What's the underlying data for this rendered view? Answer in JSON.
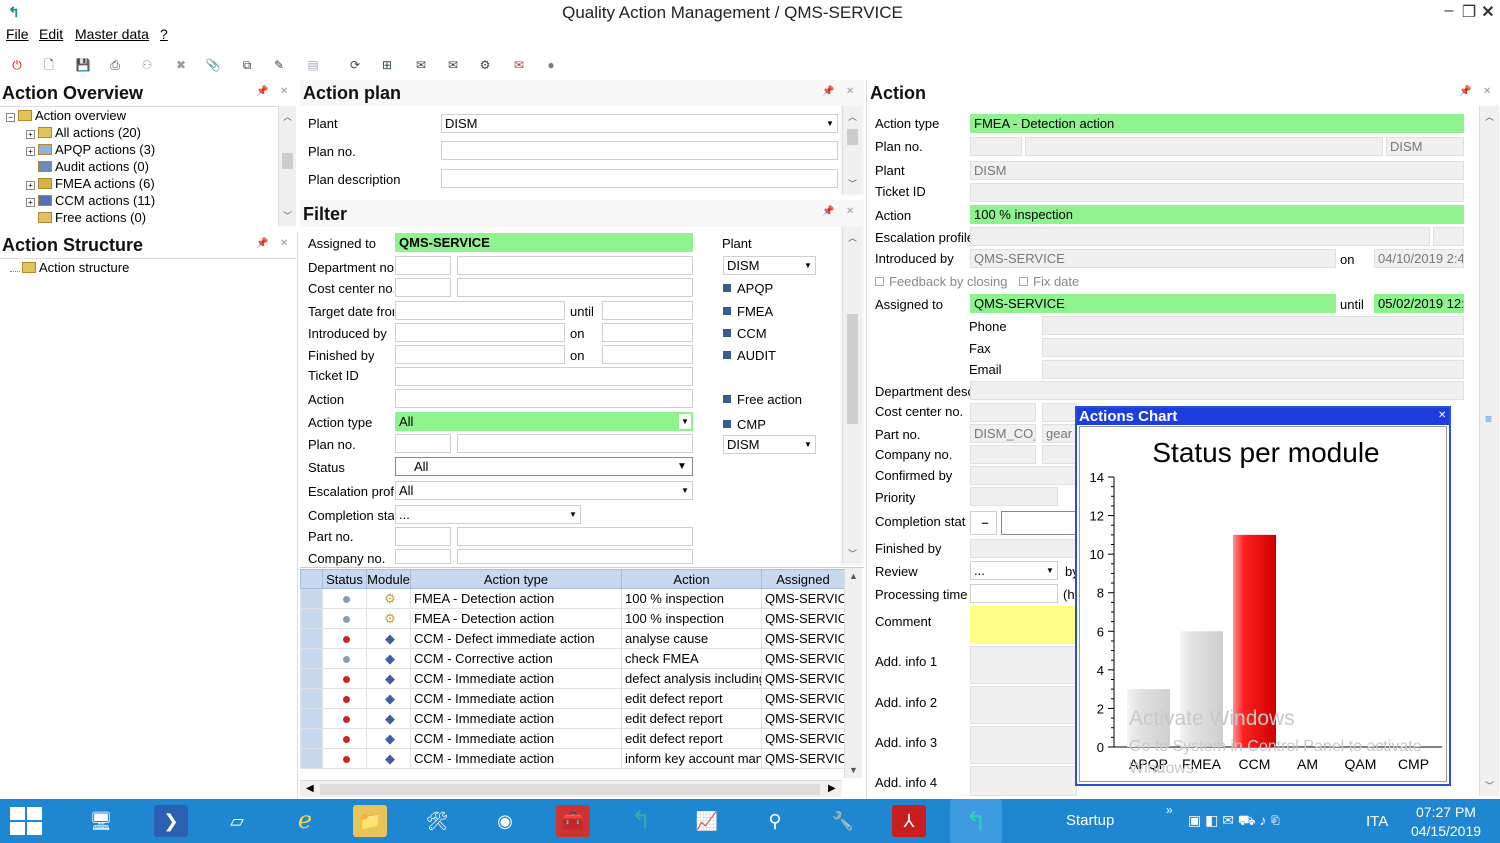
{
  "window": {
    "title": "Quality Action Management / QMS-SERVICE"
  },
  "menu": [
    "File",
    "Edit",
    "Master data",
    "?"
  ],
  "overview": {
    "title": "Action Overview",
    "items": [
      {
        "label": "Action overview"
      },
      {
        "label": "All actions (20)"
      },
      {
        "label": "APQP actions (3)"
      },
      {
        "label": "Audit actions (0)"
      },
      {
        "label": "FMEA actions (6)"
      },
      {
        "label": "CCM actions (11)"
      },
      {
        "label": "Free actions (0)"
      }
    ]
  },
  "structure": {
    "title": "Action Structure",
    "item": "Action structure"
  },
  "plan": {
    "title": "Action plan",
    "plant_label": "Plant",
    "plant_value": "DISM",
    "planno_label": "Plan no.",
    "desc_label": "Plan description"
  },
  "filter": {
    "title": "Filter",
    "assigned_label": "Assigned to",
    "assigned_value": "QMS-SERVICE",
    "dept_label": "Department no.",
    "cost_label": "Cost center no.",
    "target_label": "Target date fror",
    "until_label": "until",
    "introduced_label": "Introduced by",
    "on_label": "on",
    "finished_label": "Finished by",
    "on2_label": "on",
    "ticket_label": "Ticket ID",
    "action_label": "Action",
    "type_label": "Action type",
    "type_value": "All",
    "planno_label": "Plan no.",
    "status_label": "Status",
    "status_value": "All",
    "escal_label": "Escalation profi",
    "escal_value": "All",
    "completion_label": "Completion stat",
    "completion_value": "...",
    "part_label": "Part no.",
    "company_label": "Company no.",
    "plant_label": "Plant",
    "plant_value": "DISM",
    "modules": [
      "APQP",
      "FMEA",
      "CCM",
      "AUDIT"
    ],
    "free_label": "Free action",
    "cmp_label": "CMP",
    "cmp_value": "DISM"
  },
  "grid": {
    "columns": [
      "Status",
      "Module",
      "Action type",
      "Action",
      "Assigned"
    ],
    "rows": [
      {
        "status": "gray",
        "type": "FMEA - Detection action",
        "action": "100 % inspection",
        "assigned": "QMS-SERVIC"
      },
      {
        "status": "gray",
        "type": "FMEA - Detection action",
        "action": "100 % inspection",
        "assigned": "QMS-SERVIC"
      },
      {
        "status": "red",
        "type": "CCM - Defect immediate action",
        "action": "analyse cause",
        "assigned": "QMS-SERVIC"
      },
      {
        "status": "gray",
        "type": "CCM - Corrective action",
        "action": "check FMEA",
        "assigned": "QMS-SERVIC"
      },
      {
        "status": "red",
        "type": "CCM - Immediate action",
        "action": "defect analysis including",
        "assigned": "QMS-SERVIC"
      },
      {
        "status": "red",
        "type": "CCM - Immediate action",
        "action": "edit defect report",
        "assigned": "QMS-SERVIC"
      },
      {
        "status": "red",
        "type": "CCM - Immediate action",
        "action": "edit defect report",
        "assigned": "QMS-SERVIC"
      },
      {
        "status": "red",
        "type": "CCM - Immediate action",
        "action": "edit defect report",
        "assigned": "QMS-SERVIC"
      },
      {
        "status": "red",
        "type": "CCM - Immediate action",
        "action": "inform key account man",
        "assigned": "QMS-SERVIC"
      }
    ]
  },
  "action": {
    "title": "Action",
    "type_label": "Action type",
    "type_value": "FMEA - Detection action",
    "planno_label": "Plan no.",
    "planno_plant": "DISM",
    "plant_label": "Plant",
    "plant_value": "DISM",
    "ticket_label": "Ticket ID",
    "action_label": "Action",
    "action_value": "100 % inspection",
    "escal_label": "Escalation profile",
    "introduced_label": "Introduced by",
    "introduced_value": "QMS-SERVICE",
    "on_label": "on",
    "on_value": "04/10/2019 2:4",
    "feedback_label": "Feedback by closing",
    "fixdate_label": "Fix date",
    "assigned_label": "Assigned to",
    "assigned_value": "QMS-SERVICE",
    "until_label": "until",
    "until_value": "05/02/2019 12:(",
    "phone_label": "Phone",
    "fax_label": "Fax",
    "email_label": "Email",
    "dept_label": "Department desc",
    "cost_label": "Cost center no.",
    "part_label": "Part no.",
    "part_value": "DISM_CO_",
    "part_desc": "gear v",
    "company_label": "Company no.",
    "confirmed_label": "Confirmed by",
    "priority_label": "Priority",
    "completion_label": "Completion stat",
    "completion_btn": "–",
    "finished_label": "Finished by",
    "review_label": "Review",
    "review_value": "...",
    "review_by": "by",
    "processing_label": "Processing time",
    "processing_unit": "(h",
    "comment_label": "Comment",
    "info_labels": [
      "Add. info 1",
      "Add. info 2",
      "Add. info 3",
      "Add. info 4"
    ]
  },
  "chart_window": {
    "caption": "Actions Chart"
  },
  "chart_data": {
    "type": "bar",
    "title": "Status per module",
    "categories": [
      "APQP",
      "FMEA",
      "CCM",
      "AM",
      "QAM",
      "CMP"
    ],
    "values": [
      3,
      6,
      11,
      0,
      0,
      0
    ],
    "colors": [
      "#dcdcdc",
      "#dcdcdc",
      "#ee1111",
      "#dcdcdc",
      "#dcdcdc",
      "#dcdcdc"
    ],
    "ylim": [
      0,
      14
    ],
    "yticks": [
      0,
      2,
      4,
      6,
      8,
      10,
      12,
      14
    ]
  },
  "watermark": {
    "line1": "Activate Windows",
    "line2": "Go to System in Control Panel to activate",
    "line3": "Windows."
  },
  "taskbar": {
    "startup_label": "Startup",
    "lang": "ITA",
    "time": "07:27 PM",
    "date": "04/15/2019"
  }
}
